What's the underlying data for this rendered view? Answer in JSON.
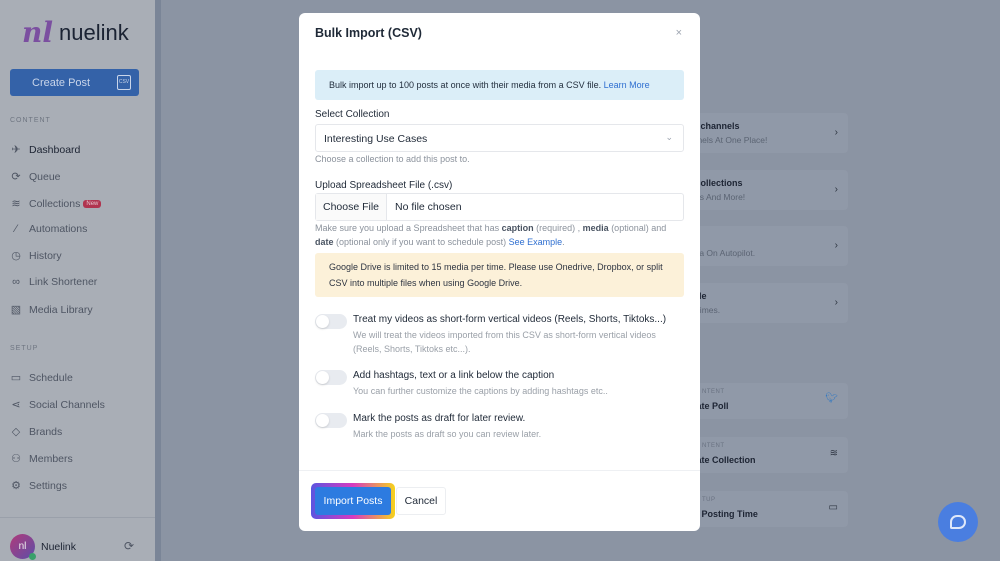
{
  "brand": {
    "name": "nuelink",
    "mark": "nl"
  },
  "sidebar": {
    "create_post": "Create Post",
    "csv_icon_label": "CSV",
    "sections": [
      "CONTENT",
      "SETUP"
    ],
    "content_items": [
      {
        "label": "Dashboard",
        "icon": "rocket-icon"
      },
      {
        "label": "Queue",
        "icon": "refresh-icon"
      },
      {
        "label": "Collections",
        "icon": "layers-icon",
        "badge": "New"
      },
      {
        "label": "Automations",
        "icon": "magic-wand-icon"
      },
      {
        "label": "History",
        "icon": "clock-icon"
      },
      {
        "label": "Link Shortener",
        "icon": "link-icon"
      },
      {
        "label": "Media Library",
        "icon": "image-icon"
      }
    ],
    "setup_items": [
      {
        "label": "Schedule",
        "icon": "calendar-icon"
      },
      {
        "label": "Social Channels",
        "icon": "share-icon"
      },
      {
        "label": "Brands",
        "icon": "tag-icon"
      },
      {
        "label": "Members",
        "icon": "users-icon"
      },
      {
        "label": "Settings",
        "icon": "gear-icon"
      }
    ],
    "user": "Nuelink"
  },
  "background_cards": [
    {
      "title": "ial channels",
      "sub": "annels At One Place!"
    },
    {
      "title": "e collections",
      "sub": "mes And More!"
    },
    {
      "title": "on",
      "sub": "edia On Autopilot."
    },
    {
      "title": "dule",
      "sub": "d Times."
    }
  ],
  "quick_actions": [
    {
      "kicker": "NTENT",
      "title": "reate Poll",
      "icon": "twitter-icon"
    },
    {
      "kicker": "NTENT",
      "title": "reate Collection",
      "icon": "layers-icon"
    },
    {
      "kicker": "TUP",
      "title": "dd Posting Time",
      "icon": "calendar-icon"
    }
  ],
  "modal": {
    "title": "Bulk Import (CSV)",
    "close": "×",
    "info": "Bulk import up to 100 posts at once with their media from a CSV file.",
    "info_link": "Learn More",
    "collection_label": "Select Collection",
    "collection_value": "Interesting Use Cases",
    "collection_help": "Choose a collection to add this post to.",
    "file_label": "Upload Spreadsheet File (.csv)",
    "choose_file": "Choose File",
    "no_file": "No file chosen",
    "file_help": {
      "p1": "Make sure you upload a Spreadsheet that has ",
      "caption": "caption",
      "p2": " (required) , ",
      "media": "media",
      "p3": " (optional) and ",
      "date": "date",
      "p4": " (optional only if you want to schedule post) ",
      "link": "See Example",
      "p5": "."
    },
    "warning": "Google Drive is limited to 15 media per time. Please use Onedrive, Dropbox, or split CSV into multiple files when using Google Drive.",
    "options": [
      {
        "title": "Treat my videos as short-form vertical videos (Reels, Shorts, Tiktoks...)",
        "desc": "We will treat the videos imported from this CSV as short-form vertical videos (Reels, Shorts, Tiktoks etc...).",
        "on": false
      },
      {
        "title": "Add hashtags, text or a link below the caption",
        "desc": "You can further customize the captions by adding hashtags etc..",
        "on": false
      },
      {
        "title": "Mark the posts as draft for later review.",
        "desc": "Mark the posts as draft so you can review later.",
        "on": false
      }
    ],
    "import": "Import Posts",
    "cancel": "Cancel"
  },
  "colors": {
    "primary": "#2d7be0",
    "overlay": "#8b94a3",
    "warning_bg": "#fcf1d9",
    "info_bg": "#dbeef8"
  }
}
